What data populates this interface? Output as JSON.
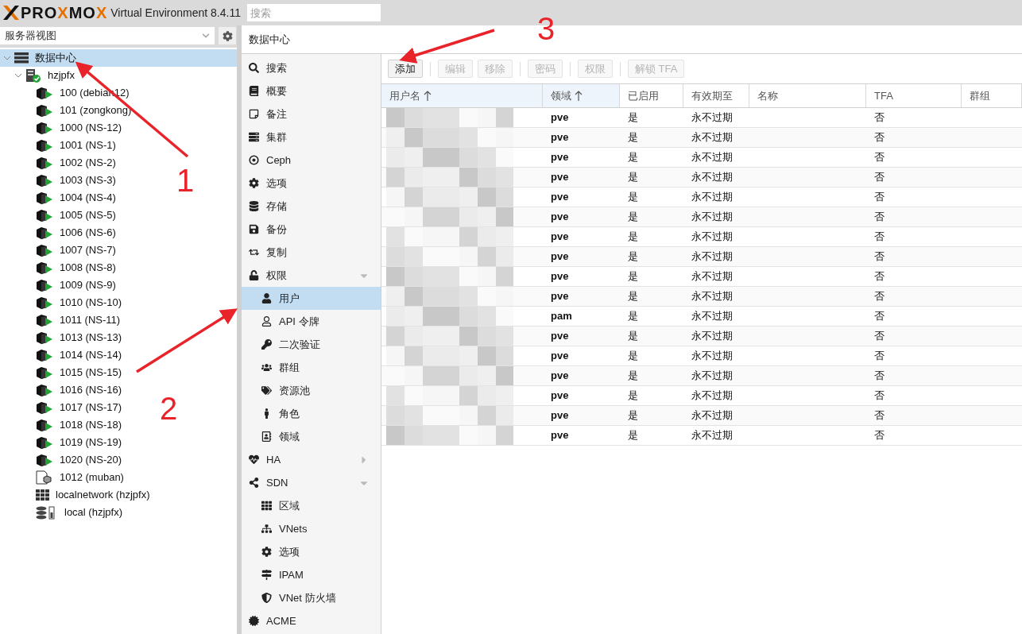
{
  "header": {
    "logo": [
      {
        "text": "PRO",
        "accent": false
      },
      {
        "text": "X",
        "accent": true
      },
      {
        "text": "MO",
        "accent": false
      },
      {
        "text": "X",
        "accent": true
      }
    ],
    "product": "Virtual Environment 8.4.11",
    "search": {
      "placeholder": "搜索"
    }
  },
  "view_selector": {
    "value": "服务器视图"
  },
  "tree": [
    {
      "label": "数据中心",
      "kind": "datacenter",
      "selected": true,
      "expanded": true,
      "children": [
        {
          "label": "hzjpfx",
          "kind": "node",
          "selected": false,
          "expanded": true,
          "children": [
            {
              "label": "100 (debian12)",
              "kind": "vm",
              "running": true
            },
            {
              "label": "101 (zongkong)",
              "kind": "vm",
              "running": true
            },
            {
              "label": "1000 (NS-12)",
              "kind": "vm",
              "running": true
            },
            {
              "label": "1001 (NS-1)",
              "kind": "vm",
              "running": true
            },
            {
              "label": "1002 (NS-2)",
              "kind": "vm",
              "running": true
            },
            {
              "label": "1003 (NS-3)",
              "kind": "vm",
              "running": true
            },
            {
              "label": "1004 (NS-4)",
              "kind": "vm",
              "running": true
            },
            {
              "label": "1005 (NS-5)",
              "kind": "vm",
              "running": true
            },
            {
              "label": "1006 (NS-6)",
              "kind": "vm",
              "running": true
            },
            {
              "label": "1007 (NS-7)",
              "kind": "vm",
              "running": true
            },
            {
              "label": "1008 (NS-8)",
              "kind": "vm",
              "running": true
            },
            {
              "label": "1009 (NS-9)",
              "kind": "vm",
              "running": true
            },
            {
              "label": "1010 (NS-10)",
              "kind": "vm",
              "running": true
            },
            {
              "label": "1011 (NS-11)",
              "kind": "vm",
              "running": true
            },
            {
              "label": "1013 (NS-13)",
              "kind": "vm",
              "running": true
            },
            {
              "label": "1014 (NS-14)",
              "kind": "vm",
              "running": true
            },
            {
              "label": "1015 (NS-15)",
              "kind": "vm",
              "running": true
            },
            {
              "label": "1016 (NS-16)",
              "kind": "vm",
              "running": true
            },
            {
              "label": "1017 (NS-17)",
              "kind": "vm",
              "running": true
            },
            {
              "label": "1018 (NS-18)",
              "kind": "vm",
              "running": true
            },
            {
              "label": "1019 (NS-19)",
              "kind": "vm",
              "running": true
            },
            {
              "label": "1020 (NS-20)",
              "kind": "vm",
              "running": true
            },
            {
              "label": "1012 (muban)",
              "kind": "template"
            },
            {
              "label": "localnetwork (hzjpfx)",
              "kind": "network"
            },
            {
              "label": "local (hzjpfx)",
              "kind": "storage"
            }
          ]
        }
      ]
    }
  ],
  "content_title": "数据中心",
  "nav": [
    {
      "label": "搜索",
      "selected": false
    },
    {
      "label": "概要",
      "selected": false
    },
    {
      "label": "备注",
      "selected": false
    },
    {
      "label": "集群",
      "selected": false
    },
    {
      "label": "Ceph",
      "selected": false
    },
    {
      "label": "选项",
      "selected": false
    },
    {
      "label": "存储",
      "selected": false
    },
    {
      "label": "备份",
      "selected": false
    },
    {
      "label": "复制",
      "selected": false
    },
    {
      "label": "权限",
      "selected": false,
      "expanded": true,
      "children": [
        {
          "label": "用户",
          "selected": true
        },
        {
          "label": "API 令牌",
          "selected": false
        },
        {
          "label": "二次验证",
          "selected": false
        },
        {
          "label": "群组",
          "selected": false
        },
        {
          "label": "资源池",
          "selected": false
        },
        {
          "label": "角色",
          "selected": false
        },
        {
          "label": "领域",
          "selected": false
        }
      ]
    },
    {
      "label": "HA",
      "selected": false,
      "expanded": false
    },
    {
      "label": "SDN",
      "selected": false,
      "expanded": true,
      "children": [
        {
          "label": "区域",
          "selected": false
        },
        {
          "label": "VNets",
          "selected": false
        },
        {
          "label": "选项",
          "selected": false
        },
        {
          "label": "IPAM",
          "selected": false
        },
        {
          "label": "VNet 防火墙",
          "selected": false
        }
      ]
    },
    {
      "label": "ACME",
      "selected": false
    }
  ],
  "toolbar": [
    [
      {
        "label": "添加",
        "disabled": false
      }
    ],
    [
      {
        "label": "编辑",
        "disabled": true
      },
      {
        "label": "移除",
        "disabled": true
      }
    ],
    [
      {
        "label": "密码",
        "disabled": true
      }
    ],
    [
      {
        "label": "权限",
        "disabled": true
      }
    ],
    [
      {
        "label": "解锁 TFA",
        "disabled": true
      }
    ]
  ],
  "table": {
    "columns": [
      {
        "label": "用户名",
        "sorted": true
      },
      {
        "label": "领域",
        "sorted": true
      },
      {
        "label": "已启用",
        "sorted": false
      },
      {
        "label": "有效期至",
        "sorted": false
      },
      {
        "label": "名称",
        "sorted": false
      },
      {
        "label": "TFA",
        "sorted": false
      },
      {
        "label": "群组",
        "sorted": false
      }
    ],
    "rows": [
      {
        "realm": "pve",
        "enabled": "是",
        "expire": "永不过期",
        "tfa": "否"
      },
      {
        "realm": "pve",
        "enabled": "是",
        "expire": "永不过期",
        "tfa": "否"
      },
      {
        "realm": "pve",
        "enabled": "是",
        "expire": "永不过期",
        "tfa": "否"
      },
      {
        "realm": "pve",
        "enabled": "是",
        "expire": "永不过期",
        "tfa": "否"
      },
      {
        "realm": "pve",
        "enabled": "是",
        "expire": "永不过期",
        "tfa": "否"
      },
      {
        "realm": "pve",
        "enabled": "是",
        "expire": "永不过期",
        "tfa": "否"
      },
      {
        "realm": "pve",
        "enabled": "是",
        "expire": "永不过期",
        "tfa": "否"
      },
      {
        "realm": "pve",
        "enabled": "是",
        "expire": "永不过期",
        "tfa": "否"
      },
      {
        "realm": "pve",
        "enabled": "是",
        "expire": "永不过期",
        "tfa": "否"
      },
      {
        "realm": "pve",
        "enabled": "是",
        "expire": "永不过期",
        "tfa": "否"
      },
      {
        "realm": "pam",
        "enabled": "是",
        "expire": "永不过期",
        "tfa": "否"
      },
      {
        "realm": "pve",
        "enabled": "是",
        "expire": "永不过期",
        "tfa": "否"
      },
      {
        "realm": "pve",
        "enabled": "是",
        "expire": "永不过期",
        "tfa": "否"
      },
      {
        "realm": "pve",
        "enabled": "是",
        "expire": "永不过期",
        "tfa": "否"
      },
      {
        "realm": "pve",
        "enabled": "是",
        "expire": "永不过期",
        "tfa": "否"
      },
      {
        "realm": "pve",
        "enabled": "是",
        "expire": "永不过期",
        "tfa": "否"
      },
      {
        "realm": "pve",
        "enabled": "是",
        "expire": "永不过期",
        "tfa": "否"
      }
    ]
  },
  "annotations": [
    {
      "label": "1"
    },
    {
      "label": "2"
    },
    {
      "label": "3"
    }
  ]
}
